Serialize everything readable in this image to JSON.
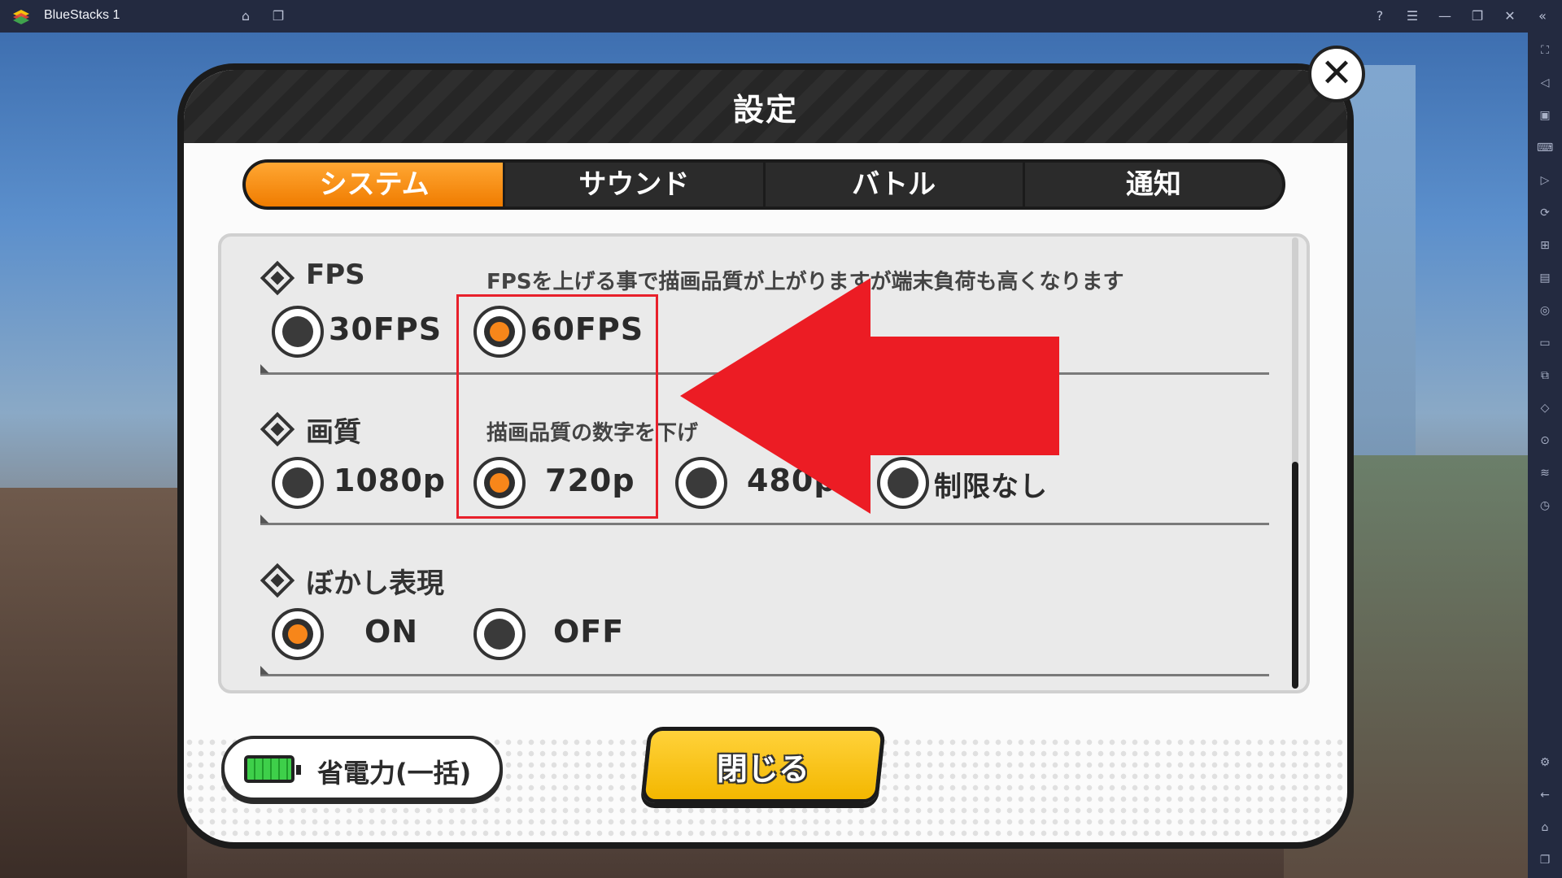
{
  "window": {
    "title": "BlueStacks 1"
  },
  "dialog": {
    "title": "設定",
    "close_icon": "close-x-icon"
  },
  "tabs": [
    {
      "label": "システム",
      "active": true
    },
    {
      "label": "サウンド",
      "active": false
    },
    {
      "label": "バトル",
      "active": false
    },
    {
      "label": "通知",
      "active": false
    }
  ],
  "sections": {
    "fps": {
      "label": "FPS",
      "description": "FPSを上げる事で描画品質が上がりますが端末負荷も高くなります",
      "options": [
        {
          "label": "30FPS",
          "selected": false
        },
        {
          "label": "60FPS",
          "selected": true
        }
      ]
    },
    "quality": {
      "label": "画質",
      "description": "描画品質の数字を下げ",
      "options": [
        {
          "label": "1080p",
          "selected": false
        },
        {
          "label": "720p",
          "selected": true
        },
        {
          "label": "480p",
          "selected": false
        },
        {
          "label": "制限なし",
          "selected": false
        }
      ]
    },
    "blur": {
      "label": "ぼかし表現",
      "options": [
        {
          "label": "ON",
          "selected": true
        },
        {
          "label": "OFF",
          "selected": false
        }
      ]
    }
  },
  "buttons": {
    "power_save": "省電力(一括)",
    "close": "閉じる"
  },
  "colors": {
    "accent_orange": "#f7861a",
    "annotation_red": "#e8202b",
    "close_button_yellow": "#ffc61a",
    "tab_bar_dark": "#2b2b2b"
  },
  "icons": {
    "titlebar": [
      "help-icon",
      "menu-icon",
      "minimize-icon",
      "restore-icon",
      "close-icon",
      "collapse-icon"
    ],
    "sidebar": [
      "fullscreen-icon",
      "volume-icon",
      "media-icon",
      "keyboard-icon",
      "macro-icon",
      "sync-icon",
      "record-icon",
      "apk-icon",
      "screenshot-icon",
      "folder-icon",
      "multi-instance-icon",
      "eco-icon",
      "location-icon",
      "layers-icon",
      "clock-icon",
      "settings-icon",
      "back-icon",
      "home-icon",
      "recent-apps-icon"
    ]
  }
}
